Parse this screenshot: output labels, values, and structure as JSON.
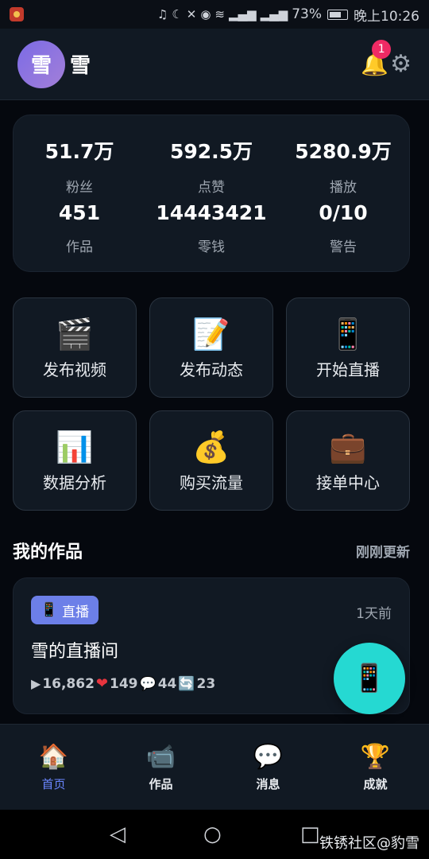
{
  "status_bar": {
    "battery": "73%",
    "time": "晚上10:26"
  },
  "header": {
    "avatar_text": "雪",
    "username": "雪",
    "notification_count": "1"
  },
  "stats": [
    {
      "value": "51.7万",
      "label": "粉丝"
    },
    {
      "value": "592.5万",
      "label": "点赞"
    },
    {
      "value": "5280.9万",
      "label": "播放"
    },
    {
      "value": "451",
      "label": "作品"
    },
    {
      "value": "14443421",
      "label": "零钱"
    },
    {
      "value": "0/10",
      "label": "警告"
    }
  ],
  "actions": [
    {
      "icon": "clapperboard-icon",
      "glyph": "🎬",
      "label": "发布视频"
    },
    {
      "icon": "memo-icon",
      "glyph": "📝",
      "label": "发布动态"
    },
    {
      "icon": "phone-icon",
      "glyph": "📱",
      "label": "开始直播"
    },
    {
      "icon": "bar-chart-icon",
      "glyph": "📊",
      "label": "数据分析"
    },
    {
      "icon": "money-bag-icon",
      "glyph": "💰",
      "label": "购买流量"
    },
    {
      "icon": "briefcase-icon",
      "glyph": "💼",
      "label": "接单中心"
    }
  ],
  "works_section": {
    "title": "我的作品",
    "link": "刚刚更新"
  },
  "work_card": {
    "tag": "直播",
    "time": "1天前",
    "title": "雪的直播间",
    "plays": "16,862",
    "likes": "149",
    "comments": "44",
    "shares": "23"
  },
  "tabs": [
    {
      "icon": "house-icon",
      "glyph": "🏠",
      "label": "首页",
      "active": true
    },
    {
      "icon": "video-camera-icon",
      "glyph": "📹",
      "label": "作品",
      "active": false
    },
    {
      "icon": "message-icon",
      "glyph": "💬",
      "label": "消息",
      "active": false
    },
    {
      "icon": "trophy-icon",
      "glyph": "🏆",
      "label": "成就",
      "active": false
    }
  ],
  "watermark": "铁锈社区@豹雪",
  "colors": {
    "background": "#05080e",
    "card": "#111923",
    "accent": "#6a86ff",
    "tag": "#6c7fe8",
    "fab": "#25d9d2",
    "badge": "#ef2a64",
    "bell": "#f5b51c"
  }
}
